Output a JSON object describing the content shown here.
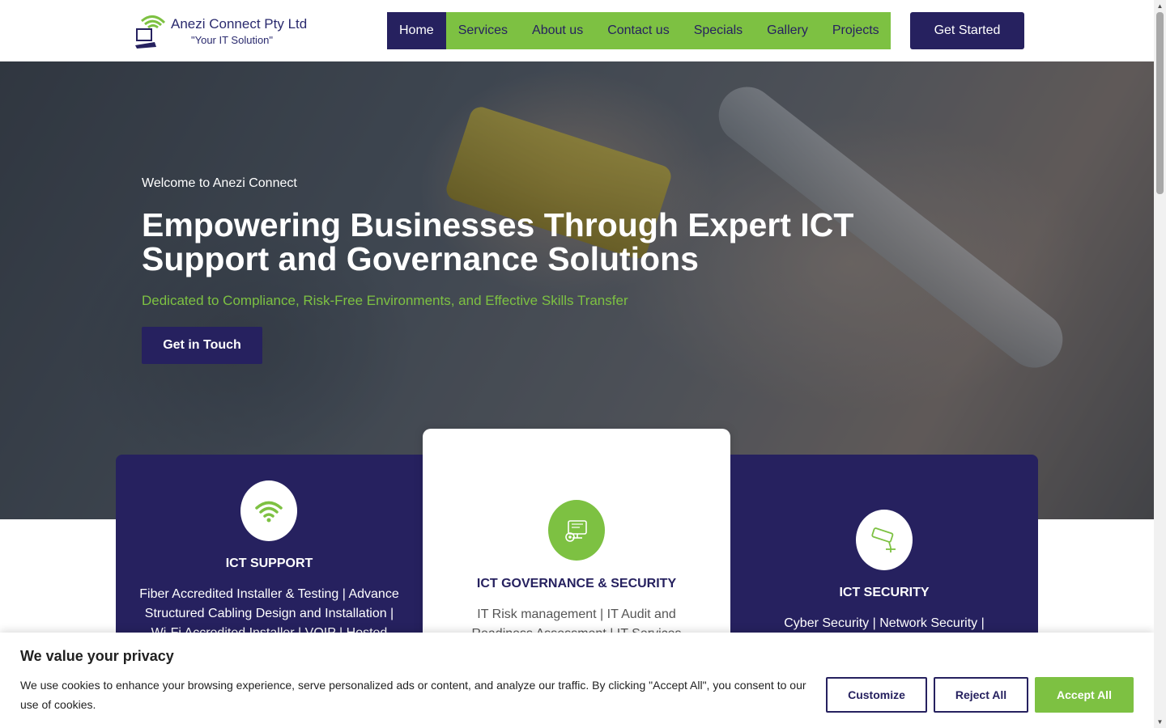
{
  "header": {
    "logo_title": "Anezi Connect Pty Ltd",
    "logo_tagline": "\"Your IT Solution\"",
    "nav": [
      {
        "label": "Home"
      },
      {
        "label": "Services"
      },
      {
        "label": "About us"
      },
      {
        "label": "Contact us"
      },
      {
        "label": "Specials"
      },
      {
        "label": "Gallery"
      },
      {
        "label": "Projects"
      }
    ],
    "cta_label": "Get Started"
  },
  "hero": {
    "welcome": "Welcome to Anezi Connect",
    "title": "Empowering Businesses Through Expert ICT Support and Governance Solutions",
    "subtitle": "Dedicated to Compliance, Risk-Free Environments, and Effective Skills Transfer",
    "button_label": "Get in Touch"
  },
  "services": [
    {
      "title": "ICT SUPPORT",
      "text": "Fiber Accredited Installer & Testing | Advance Structured Cabling Design and Installation | Wi-Fi Accredited Installer | VOIP | Hosted PBX",
      "icon": "wifi-icon"
    },
    {
      "title": "ICT GOVERNANCE & SECURITY",
      "text": "IT Risk management | IT Audit and Readiness Assessment | IT Services",
      "icon": "gear-monitor-icon"
    },
    {
      "title": "ICT SECURITY",
      "text": "Cyber Security | Network Security |",
      "icon": "cctv-camera-icon"
    }
  ],
  "cookie": {
    "title": "We value your privacy",
    "text": "We use cookies to enhance your browsing experience, serve personalized ads or content, and analyze our traffic. By clicking \"Accept All\", you consent to our use of cookies.",
    "customize_label": "Customize",
    "reject_label": "Reject All",
    "accept_label": "Accept All"
  },
  "colors": {
    "brand_navy": "#26215f",
    "brand_green": "#7dc142"
  }
}
